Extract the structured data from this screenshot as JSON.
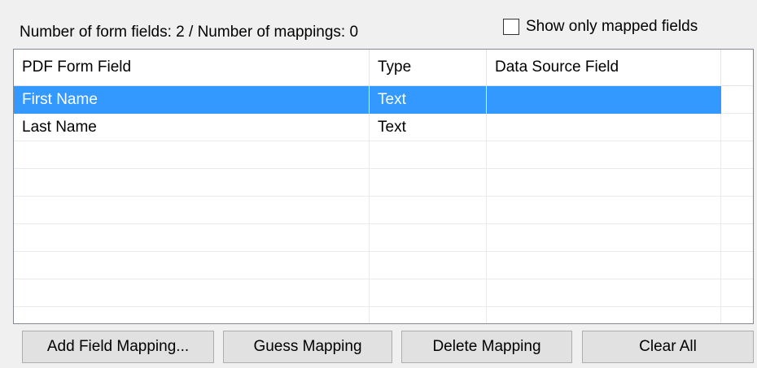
{
  "summary": {
    "text": "Number of form fields: 2 / Number of mappings: 0"
  },
  "show_mapped": {
    "label": "Show only mapped fields",
    "checked": false
  },
  "grid": {
    "columns": [
      "PDF Form Field",
      "Type",
      "Data Source Field",
      ""
    ],
    "rows": [
      {
        "pdf_field": "First Name",
        "type": "Text",
        "data_source": "",
        "selected": true
      },
      {
        "pdf_field": "Last Name",
        "type": "Text",
        "data_source": "",
        "selected": false
      },
      {
        "pdf_field": "",
        "type": "",
        "data_source": "",
        "selected": false
      },
      {
        "pdf_field": "",
        "type": "",
        "data_source": "",
        "selected": false
      },
      {
        "pdf_field": "",
        "type": "",
        "data_source": "",
        "selected": false
      },
      {
        "pdf_field": "",
        "type": "",
        "data_source": "",
        "selected": false
      },
      {
        "pdf_field": "",
        "type": "",
        "data_source": "",
        "selected": false
      },
      {
        "pdf_field": "",
        "type": "",
        "data_source": "",
        "selected": false
      },
      {
        "pdf_field": "",
        "type": "",
        "data_source": "",
        "selected": false
      }
    ],
    "selection_color": "#3399ff"
  },
  "buttons": {
    "add_field_mapping": "Add Field Mapping...",
    "guess_mapping": "Guess Mapping",
    "delete_mapping": "Delete Mapping",
    "clear_all": "Clear All"
  }
}
